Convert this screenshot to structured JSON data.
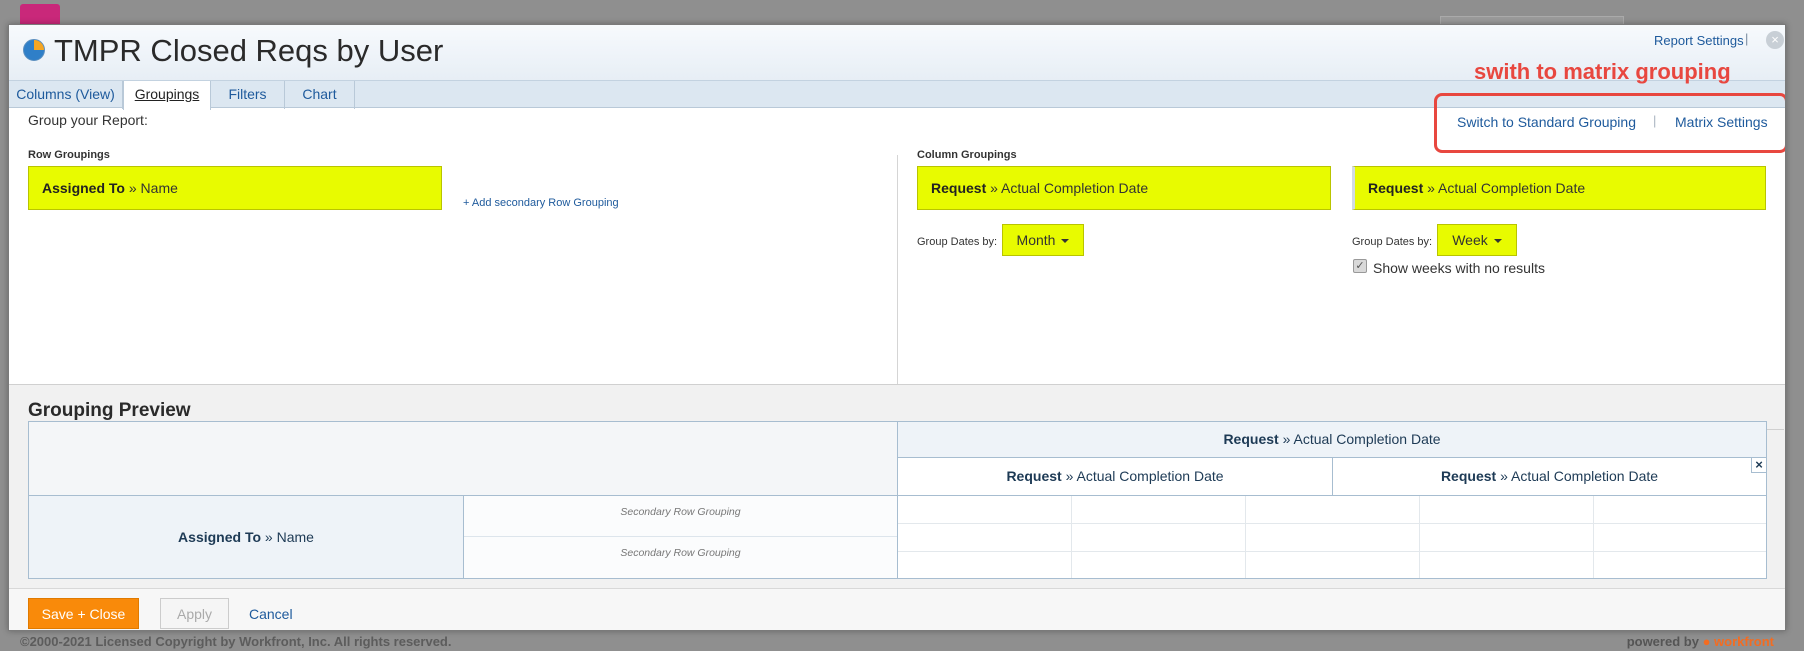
{
  "modal": {
    "title": "TMPR Closed Reqs by User",
    "report_settings": "Report Settings",
    "separator": "|",
    "close_glyph": "×"
  },
  "tabs": [
    {
      "label": "Columns (View)",
      "active": false
    },
    {
      "label": "Groupings",
      "active": true
    },
    {
      "label": "Filters",
      "active": false
    },
    {
      "label": "Chart",
      "active": false
    }
  ],
  "annotation": {
    "text": "swith to matrix grouping",
    "color": "#e8473f"
  },
  "groupings": {
    "intro": "Group your Report:",
    "switch_standard": "Switch to Standard Grouping",
    "separator": "|",
    "matrix_settings": "Matrix Settings",
    "row_groupings_label": "Row Groupings",
    "row_grouping": {
      "object": "Assigned To",
      "arrow": "»",
      "field": "Name"
    },
    "add_secondary": "+ Add secondary Row Grouping",
    "column_groupings_label": "Column Groupings",
    "column_grouping_1": {
      "object": "Request",
      "arrow": "»",
      "field": "Actual Completion Date"
    },
    "column_grouping_2": {
      "object": "Request",
      "arrow": "»",
      "field": "Actual Completion Date"
    },
    "group_dates_by_label": "Group Dates by:",
    "dates_by_1": "Month",
    "dates_by_2": "Week",
    "show_weeks_checked": true,
    "show_weeks_label": "Show weeks with no results",
    "highlight_color": "#e8fb00"
  },
  "preview": {
    "title": "Grouping Preview",
    "top_header": {
      "object": "Request",
      "arrow": "»",
      "field": "Actual Completion Date"
    },
    "sub_header_1": {
      "object": "Request",
      "arrow": "»",
      "field": "Actual Completion Date"
    },
    "sub_header_2": {
      "object": "Request",
      "arrow": "»",
      "field": "Actual Completion Date"
    },
    "row_header": {
      "object": "Assigned To",
      "arrow": "»",
      "field": "Name"
    },
    "secondary_1": "Secondary Row Grouping",
    "secondary_2": "Secondary Row Grouping",
    "remove_glyph": "×"
  },
  "footer": {
    "save_close": "Save + Close",
    "apply": "Apply",
    "cancel": "Cancel",
    "accent": "#f98a0a"
  },
  "background": {
    "copyright": "©2000-2021 Licensed Copyright by Workfront, Inc. All rights reserved.",
    "powered_by": "powered by",
    "brand": "workfront"
  }
}
